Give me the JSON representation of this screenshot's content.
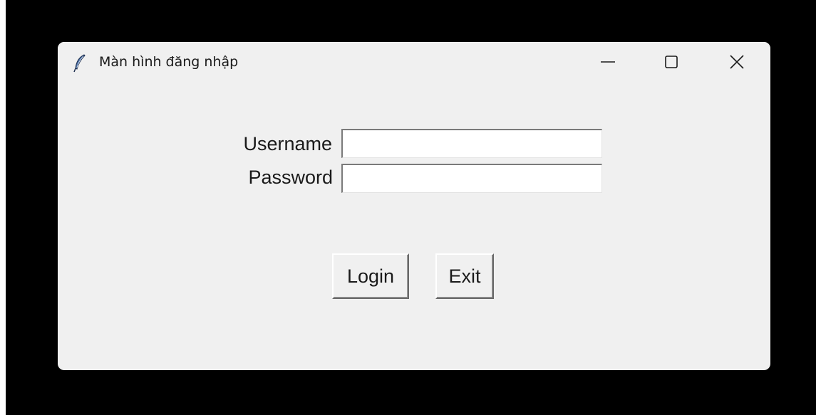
{
  "window": {
    "title": "Màn hình đăng nhập",
    "icon": "feather-icon",
    "controls": {
      "minimize_icon": "minimize-icon",
      "maximize_icon": "maximize-icon",
      "close_icon": "close-icon"
    }
  },
  "form": {
    "username_label": "Username",
    "username_value": "",
    "password_label": "Password",
    "password_value": ""
  },
  "buttons": {
    "login_label": "Login",
    "exit_label": "Exit"
  },
  "colors": {
    "window_background": "#f0f0f0",
    "desktop_background": "#000000",
    "entry_background": "#ffffff"
  }
}
